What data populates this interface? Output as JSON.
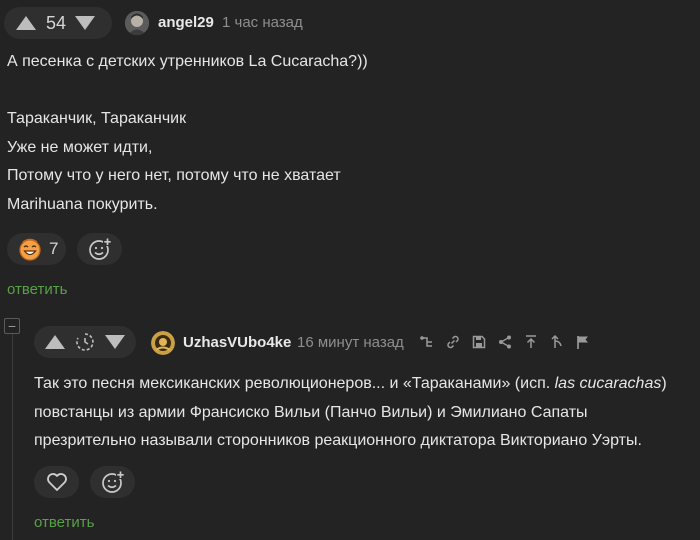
{
  "comment1": {
    "rating": "54",
    "username": "angel29",
    "time": "1 час назад",
    "lines": [
      "А песенка с детских утренников La Cucaracha?))",
      "",
      "Тараканчик, Тараканчик",
      "Уже не может идти,",
      "Потому что у него нет, потому что не хватает",
      "Marihuana покурить."
    ],
    "reaction_count": "7",
    "reply_label": "ответить"
  },
  "comment2": {
    "username": "UzhasVUbo4ke",
    "time": "16 минут назад",
    "line1": "Так это песня мексиканских революционеров... и «Тараканами» (исп. ",
    "line1_italic": "las cucarachas",
    "line1_end": ")",
    "line2": "повстанцы из армии Франсиско Вильи (Панчо Вильи) и Эмилиано Сапаты",
    "line3": "презрительно называли сторонников реакционного диктатора Викториано Уэрты.",
    "reply_label": "ответить"
  },
  "collapse_glyph": "−",
  "colors": {
    "background": "#232323",
    "pill": "#2f2f30",
    "reply": "#58a147",
    "muted": "#8e8e8e"
  },
  "icons": [
    "arrow-up-icon",
    "arrow-down-icon",
    "avatar",
    "smile-emoji-icon",
    "add-reaction-icon",
    "timer-icon",
    "heart-icon",
    "collapse-icon",
    "share-tree-icon",
    "link-icon",
    "save-icon",
    "share-icon",
    "go-up-icon",
    "branch-icon",
    "flag-icon"
  ]
}
